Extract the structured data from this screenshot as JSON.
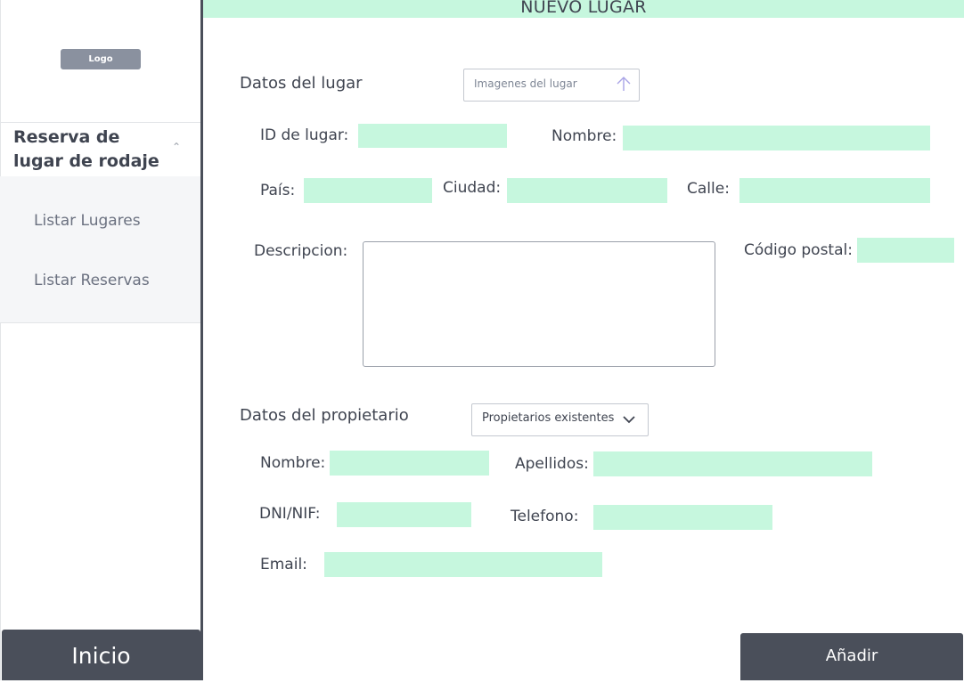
{
  "sidebar": {
    "logo": "Logo",
    "menu_title": "Reserva de lugar de rodaje",
    "items": [
      {
        "label": "Listar Lugares"
      },
      {
        "label": "Listar Reservas"
      }
    ],
    "home_button": "Inicio"
  },
  "header": {
    "title": "NUEVO LUGAR"
  },
  "place": {
    "section_label": "Datos del lugar",
    "upload_label": "Imagenes del lugar",
    "upload_icon": "arrow-up-icon",
    "id_label": "ID de lugar:",
    "name_label": "Nombre:",
    "country_label": "País:",
    "city_label": "Ciudad:",
    "street_label": "Calle:",
    "description_label": "Descripcion:",
    "postal_label": "Código postal:"
  },
  "owner": {
    "section_label": "Datos del propietario",
    "select_value": "Propietarios existentes",
    "select_icon": "chevron-down-icon",
    "name_label": "Nombre:",
    "surname_label": "Apellidos:",
    "dni_label": "DNI/NIF:",
    "phone_label": "Telefono:",
    "email_label": "Email:"
  },
  "actions": {
    "add_label": "Añadir"
  },
  "colors": {
    "field_fill": "#c6f7de",
    "dark": "#4a4f5a",
    "text": "#3f4450"
  }
}
